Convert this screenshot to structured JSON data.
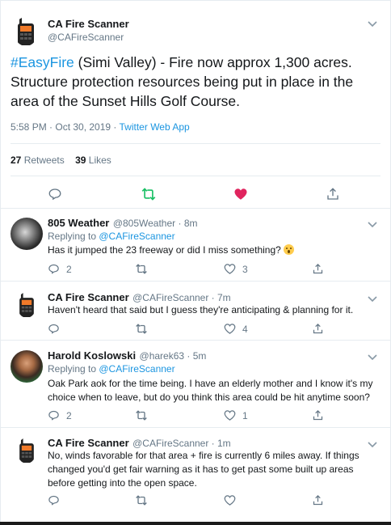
{
  "main": {
    "author_name": "CA Fire Scanner",
    "author_handle": "@CAFireScanner",
    "hashtag": "#EasyFire",
    "text": " (Simi Valley) - Fire now approx 1,300 acres. Structure protection resources being put in place in the area of the Sunset Hills Golf Course.",
    "timestamp": "5:58 PM · Oct 30, 2019 · ",
    "source": "Twitter Web App",
    "retweets_count": "27",
    "retweets_label": "Retweets",
    "likes_count": "39",
    "likes_label": "Likes"
  },
  "replies": [
    {
      "author_name": "805 Weather",
      "author_handle": "@805Weather",
      "time": " · 8m",
      "replying_label": "Replying to ",
      "replying_to": "@CAFireScanner",
      "text": "Has it jumped the 23 freeway or did I miss something? ",
      "reply_count": "2",
      "retweet_count": "",
      "like_count": "3"
    },
    {
      "author_name": "CA Fire Scanner",
      "author_handle": "@CAFireScanner",
      "time": " · 7m",
      "text": "Haven't heard that said but I guess they're anticipating & planning for it.",
      "reply_count": "",
      "retweet_count": "",
      "like_count": "4"
    },
    {
      "author_name": "Harold Koslowski",
      "author_handle": "@harek63",
      "time": " · 5m",
      "replying_label": "Replying to ",
      "replying_to": "@CAFireScanner",
      "text": "Oak Park aok for the time being.  I have an elderly mother and I know it's my choice when to leave, but do you think this area could be hit anytime soon?",
      "reply_count": "2",
      "retweet_count": "",
      "like_count": "1"
    },
    {
      "author_name": "CA Fire Scanner",
      "author_handle": "@CAFireScanner",
      "time": " · 1m",
      "text": "No, winds favorable for that area + fire is currently 6 miles away. If things changed you'd get fair warning as it has to get past some built up areas before getting into the open space.",
      "reply_count": "",
      "retweet_count": "",
      "like_count": ""
    }
  ],
  "colors": {
    "link": "#1b95e0",
    "retweet_green": "#17bf63",
    "like_red": "#e0245e",
    "muted": "#657786"
  },
  "icons": {
    "reply": "reply-icon",
    "retweet": "retweet-icon",
    "like": "heart-icon",
    "share": "share-icon",
    "menu": "chevron-down-icon"
  }
}
